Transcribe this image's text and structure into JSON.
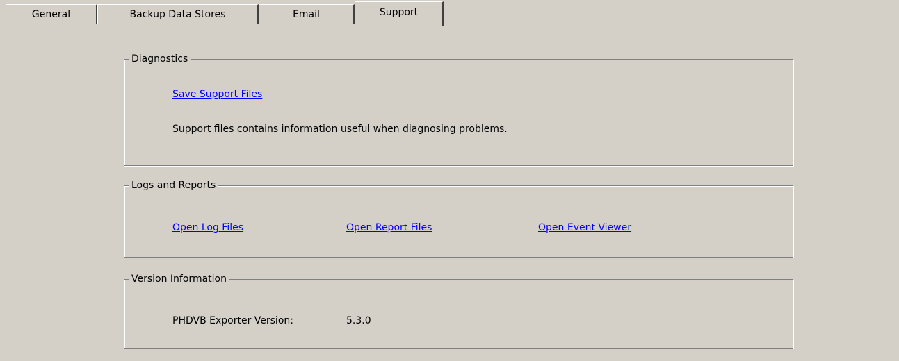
{
  "tabs": [
    {
      "label": "General"
    },
    {
      "label": "Backup Data Stores"
    },
    {
      "label": "Email"
    },
    {
      "label": "Support"
    }
  ],
  "active_tab": "Support",
  "diagnostics": {
    "title": "Diagnostics",
    "save_link": "Save Support Files",
    "description": "Support files contains information useful when diagnosing problems."
  },
  "logs": {
    "title": "Logs and Reports",
    "open_log_files": "Open Log Files",
    "open_report_files": "Open Report Files",
    "open_event_viewer": "Open Event Viewer"
  },
  "version": {
    "title": "Version Information",
    "label": "PHDVB Exporter Version:",
    "value": "5.3.0"
  },
  "colors": {
    "background": "#d4d0c8",
    "link": "#0000ff"
  }
}
